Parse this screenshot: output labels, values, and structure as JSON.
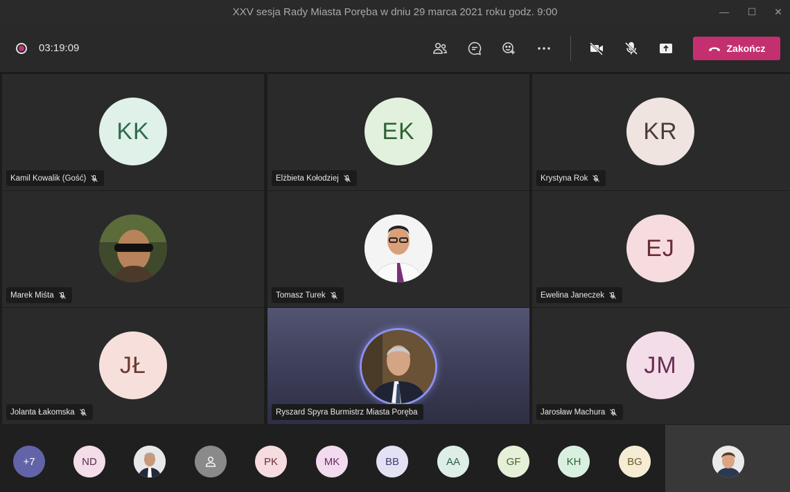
{
  "window": {
    "title": "XXV sesja Rady Miasta Poręba w dniu 29 marca 2021 roku godz. 9:00",
    "minimize_glyph": "—",
    "maximize_glyph": "☐",
    "close_glyph": "✕"
  },
  "toolbar": {
    "timer": "03:19:09",
    "end_label": "Zakończ",
    "icons": [
      "people-icon",
      "chat-icon",
      "reactions-icon",
      "more-icon",
      "camera-off-icon",
      "mic-off-icon",
      "share-icon"
    ],
    "end_color": "#c4306f"
  },
  "tiles": [
    {
      "name": "Kamil Kowalik (Gość)",
      "initials": "KK",
      "avatar_bg": "#dff1e8",
      "avatar_fg": "#2f6b4e",
      "type": "initials"
    },
    {
      "name": "Elżbieta Kołodziej",
      "initials": "EK",
      "avatar_bg": "#e2f1de",
      "avatar_fg": "#2f6434",
      "type": "initials"
    },
    {
      "name": "Krystyna Rok",
      "initials": "KR",
      "avatar_bg": "#efe4e0",
      "avatar_fg": "#4a3c36",
      "type": "initials"
    },
    {
      "name": "Marek Miśta",
      "initials": "",
      "avatar_bg": "#6b5a45",
      "avatar_fg": "#fff",
      "type": "photo"
    },
    {
      "name": "Tomasz Turek",
      "initials": "",
      "avatar_bg": "#f2f2f2",
      "avatar_fg": "#000",
      "type": "photo"
    },
    {
      "name": "Ewelina Janeczek",
      "initials": "EJ",
      "avatar_bg": "#f6dcde",
      "avatar_fg": "#6a2b35",
      "type": "initials"
    },
    {
      "name": "Jolanta Łakomska",
      "initials": "JŁ",
      "avatar_bg": "#f7e0dc",
      "avatar_fg": "#6c3a2e",
      "type": "initials"
    },
    {
      "name": "Ryszard Spyra Burmistrz Miasta Poręba",
      "initials": "",
      "avatar_bg": "#5a4a3c",
      "avatar_fg": "#fff",
      "type": "photo",
      "active": true
    },
    {
      "name": "Jarosław Machura",
      "initials": "JM",
      "avatar_bg": "#f3dde9",
      "avatar_fg": "#6a2d54",
      "type": "initials"
    }
  ],
  "roster": [
    {
      "label": "+7",
      "bg": "#6264a7",
      "fg": "#ffffff"
    },
    {
      "label": "ND",
      "bg": "#f3dde9",
      "fg": "#5d2a4c"
    },
    {
      "label": "",
      "bg": "#d9d9d9",
      "fg": "#000",
      "photo": true
    },
    {
      "label": "",
      "bg": "#8a8a8a",
      "fg": "#fff",
      "generic": true
    },
    {
      "label": "PK",
      "bg": "#f6dce0",
      "fg": "#6b2d38"
    },
    {
      "label": "MK",
      "bg": "#f3dbef",
      "fg": "#662c5c"
    },
    {
      "label": "BB",
      "bg": "#e3e2f5",
      "fg": "#3f3d6b"
    },
    {
      "label": "AA",
      "bg": "#dceee6",
      "fg": "#2f5e4a"
    },
    {
      "label": "GF",
      "bg": "#e6f0d8",
      "fg": "#4a5e2e"
    },
    {
      "label": "KH",
      "bg": "#d9f0e0",
      "fg": "#2c6040"
    },
    {
      "label": "BG",
      "bg": "#f5ecd3",
      "fg": "#6b5a2a"
    }
  ]
}
